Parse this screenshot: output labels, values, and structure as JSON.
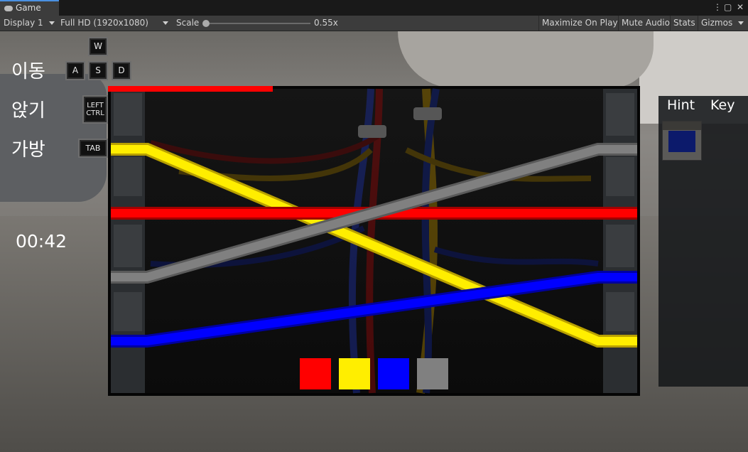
{
  "window": {
    "tab_title": "Game",
    "more_icon": "⋮",
    "maximize_icon": "▢",
    "close_icon": "✕"
  },
  "toolbar": {
    "display": "Display 1",
    "resolution": "Full HD (1920x1080)",
    "scale_label": "Scale",
    "scale_value": "0.55x",
    "maximize": "Maximize On Play",
    "mute": "Mute Audio",
    "stats": "Stats",
    "gizmos": "Gizmos"
  },
  "hud": {
    "move_label": "이동",
    "crouch_label": "앉기",
    "bag_label": "가방",
    "keys": {
      "w": "W",
      "a": "A",
      "s": "S",
      "d": "D",
      "ctrl_line1": "LEFT",
      "ctrl_line2": "CTRL",
      "tab": "TAB"
    },
    "timer": "00:42"
  },
  "hint_panel": {
    "tab_hint": "Hint",
    "tab_key": "Key"
  },
  "puzzle": {
    "progress": 0.31,
    "colors": {
      "red": "#ff0000",
      "yellow": "#ffee00",
      "blue": "#0000ff",
      "gray": "#808080"
    },
    "wires": [
      {
        "color": "yellow",
        "left_slot": 1,
        "right_slot": 4
      },
      {
        "color": "red",
        "left_slot": 2,
        "right_slot": 2
      },
      {
        "color": "gray",
        "left_slot": 3,
        "right_slot": 1
      },
      {
        "color": "blue",
        "left_slot": 4,
        "right_slot": 3
      }
    ],
    "swatches": [
      "red",
      "yellow",
      "blue",
      "gray"
    ]
  }
}
